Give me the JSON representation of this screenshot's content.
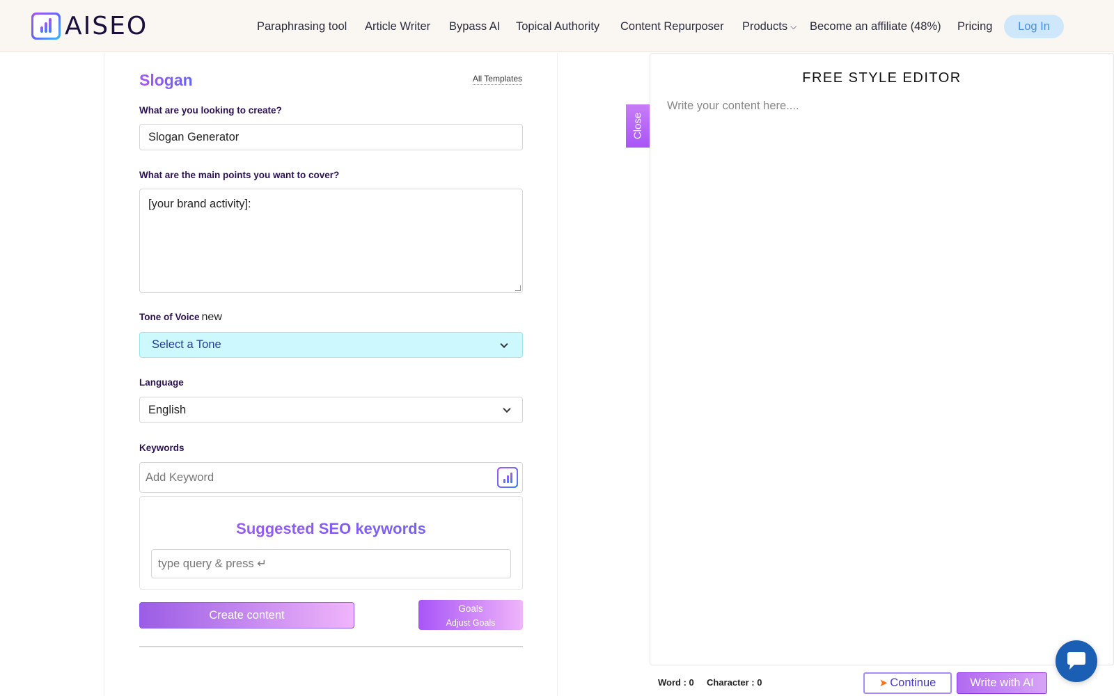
{
  "brand": {
    "name": "AISEO"
  },
  "nav": {
    "items": [
      {
        "label": "Paraphrasing tool"
      },
      {
        "label": "Article Writer"
      },
      {
        "label": "Bypass AI"
      },
      {
        "label": "Topical Authority"
      },
      {
        "label": "Content Repurposer"
      },
      {
        "label": "Products"
      },
      {
        "label": "Become an affiliate (48%)"
      },
      {
        "label": "Pricing"
      }
    ],
    "login_label": "Log In"
  },
  "form": {
    "title": "Slogan",
    "all_templates_label": "All Templates",
    "create_label": "What are you looking to create?",
    "create_value": "Slogan Generator",
    "points_label": "What are the main points you want to cover?",
    "points_value": "[your brand activity]:",
    "tone_label": "Tone of Voice",
    "tone_badge": "new",
    "tone_value": "Select a Tone",
    "language_label": "Language",
    "language_value": "English",
    "keywords_label": "Keywords",
    "keyword_placeholder": "Add Keyword",
    "seo_title": "Suggested SEO keywords",
    "seo_query_placeholder": "type query & press ↵",
    "create_button": "Create content",
    "goals_title": "Goals",
    "goals_subtitle": "Adjust Goals"
  },
  "editor": {
    "close_label": "Close",
    "title": "FREE STYLE EDITOR",
    "placeholder": "Write your content here....",
    "word_count": "Word : 0",
    "char_count": "Character : 0",
    "continue_label": "Continue",
    "write_label": "Write with AI"
  },
  "colors": {
    "accent_purple": "#a855f7",
    "accent_indigo": "#6366f1",
    "tone_bg": "#cdf8fd",
    "login_bg": "#cfe7fb",
    "chat_blue": "#1a5fb4"
  }
}
